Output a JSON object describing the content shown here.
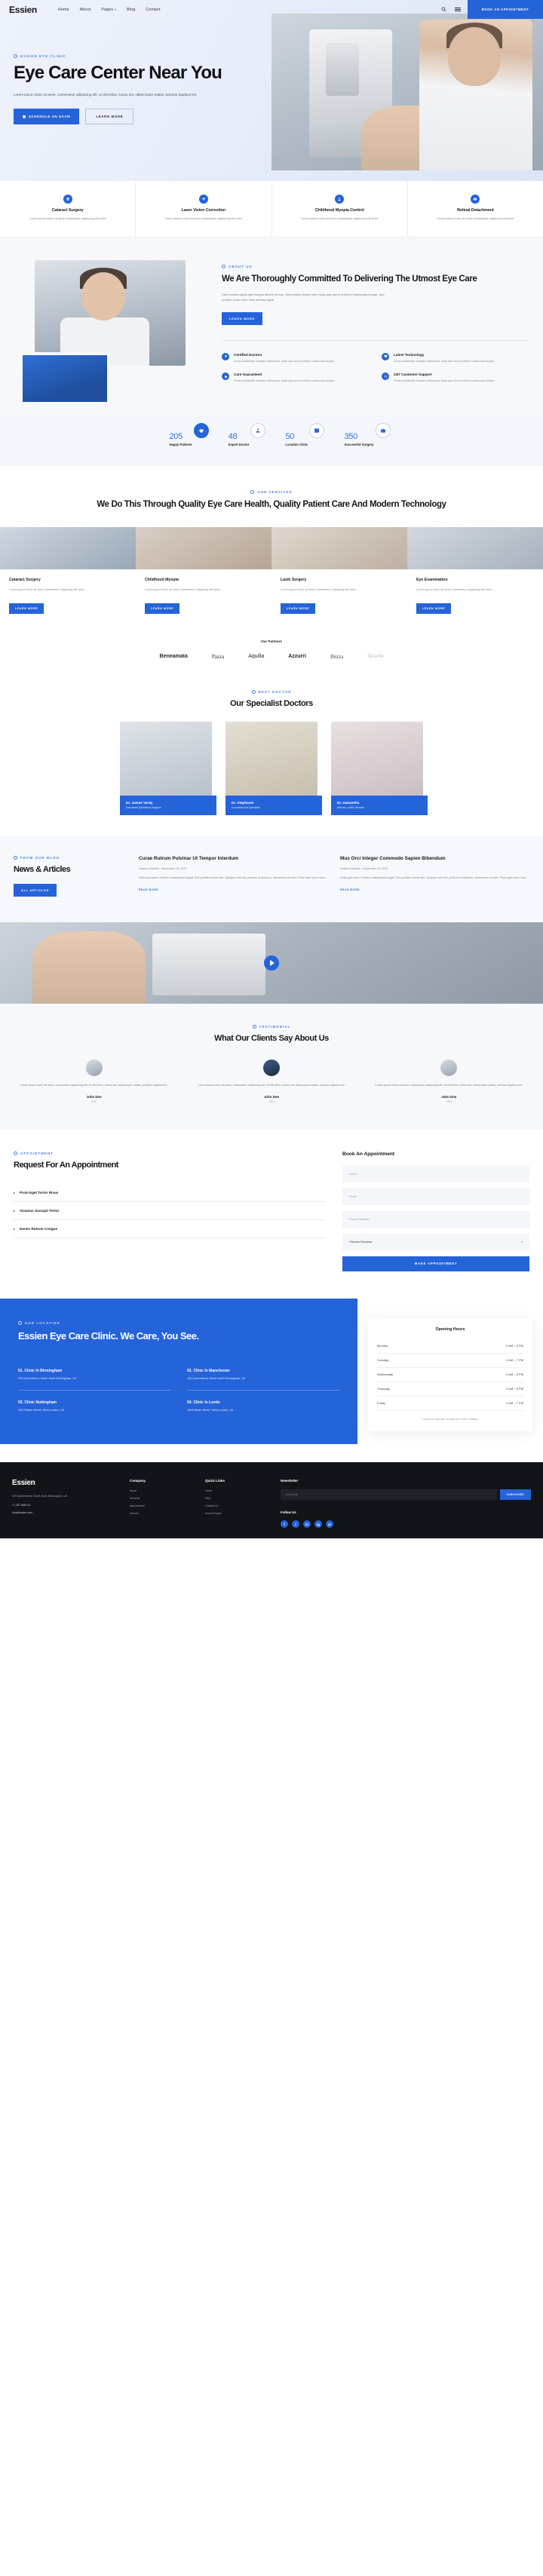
{
  "header": {
    "logo": "Essien",
    "nav": [
      {
        "label": "Home",
        "caret": false
      },
      {
        "label": "About",
        "caret": false
      },
      {
        "label": "Pages",
        "caret": true
      },
      {
        "label": "Blog",
        "caret": false
      },
      {
        "label": "Contact",
        "caret": false
      }
    ],
    "cta": "BOOK AN APPOINTMENT",
    "accent": "#2563d9"
  },
  "hero": {
    "eyebrow": "ESSIEN EYE CLINIC",
    "title": "Eye Care Center Near You",
    "paragraph": "Lorem ipsum dolor sit amet, consectetur adipiscing elit. Ut elit tellus, luctus nec ullamcorper mattis, pulvinar dapibus leo.",
    "primary_btn": "SCHEDULE AN EXAM",
    "secondary_btn": "LEARN MORE"
  },
  "strip": {
    "desc": "Lorem ipsum dolor sit amet consectetur adipiscing elit dolor",
    "items": [
      {
        "title": "Cataract Surgery",
        "icon": "surgery-icon"
      },
      {
        "title": "Laser Vision Correction",
        "icon": "laser-icon"
      },
      {
        "title": "Childhood Myopia Control",
        "icon": "child-icon"
      },
      {
        "title": "Retinal Detachment",
        "icon": "eye-icon"
      }
    ]
  },
  "about": {
    "eyebrow": "ABOUT US",
    "title": "We Are Thoroughly Committed To Delivering The Utmost Eye Care",
    "paragraph": "Duis rhoncus ligula eget magna dictum cursus. Sed porttitor lectus nibh. Nulla quis lorem ut libero malesuada feugiat. Sed porttitor lectus nibh. Duis ultricies ligula.",
    "button": "LEARN MORE",
    "features": [
      {
        "title": "Certified Doctors",
        "text": "Donec sollicitudin molestie malesuada. Nulla quis lorem ut libero malesuada feugiat.",
        "icon": "badge-icon"
      },
      {
        "title": "Latest Technology",
        "text": "Donec sollicitudin molestie malesuada. Nulla quis lorem ut libero malesuada feugiat.",
        "icon": "tech-icon"
      },
      {
        "title": "Care Guaranteed",
        "text": "Donec sollicitudin molestie malesuada. Nulla quis lorem ut libero malesuada feugiat.",
        "icon": "heart-icon"
      },
      {
        "title": "24/7 Customer Support",
        "text": "Donec sollicitudin molestie malesuada. Nulla quis lorem ut libero malesuada feugiat.",
        "icon": "support-icon"
      }
    ]
  },
  "stats": [
    {
      "number": "205",
      "label": "Happy Patients",
      "icon": "heart-icon"
    },
    {
      "number": "48",
      "label": "Expert Doctor",
      "icon": "doctor-icon"
    },
    {
      "number": "50",
      "label": "Location Clinic",
      "icon": "map-icon"
    },
    {
      "number": "350",
      "label": "Successful Surgery",
      "icon": "bag-icon"
    }
  ],
  "services": {
    "eyebrow": "OUR SERVICES",
    "title": "We Do This Through Quality Eye Care Health, Quality Patient Care And Modern Technology",
    "cards": [
      {
        "title": "Cataract Surgery",
        "text": "Lorem ipsum dolor sit amet consectetur adipiscing elit dolor",
        "button": "LEARN MORE"
      },
      {
        "title": "Childhood Myopia",
        "text": "Lorem ipsum dolor sit amet consectetur adipiscing elit dolor",
        "button": "LEARN MORE"
      },
      {
        "title": "Lasik Surgery",
        "text": "Lorem ipsum dolor sit amet consectetur adipiscing elit dolor",
        "button": "LEARN MORE"
      },
      {
        "title": "Eye Examination",
        "text": "Lorem ipsum dolor sit amet consectetur adipiscing elit dolor",
        "button": "LEARN MORE"
      }
    ]
  },
  "partners": {
    "title": "Our Partners",
    "logos": [
      "Beneamata",
      "Pazza",
      "Aquilla",
      "Azzurri",
      "Ibizza",
      "Tenerife"
    ]
  },
  "doctors": {
    "eyebrow": "BEST DOCTOR",
    "title": "Our Specialist Doctors",
    "list": [
      {
        "name": "Dr. James Verdy",
        "role": "Consultant Ophthalmic Surgeon"
      },
      {
        "name": "Dr. Stephanie",
        "role": "Consultant Eye Specialist"
      },
      {
        "name": "Dr. Samantha",
        "role": "Director, LASIK Services"
      }
    ]
  },
  "news": {
    "eyebrow": "FROM OUR BLOG",
    "title": "News & Articles",
    "button": "ALL ARTICLES",
    "posts": [
      {
        "title": "Curae Rutrum Pulvinar Ut Tempor Interdum",
        "meta": "Hassan Mustafa - September 18, 2023",
        "excerpt": "Nulla quis lorem ut libero malesuada feugiat. Sed porttitor lectus nibh. Quisque velit nisi, pretium ut lacinia in, elementum id enim. Proin eget tortor risus.",
        "read_more": "READ MORE"
      },
      {
        "title": "Mus Orci Integer Commodo Sapien Bibendum",
        "meta": "Hassan Mustafa - September 18, 2023",
        "excerpt": "Nulla quis lorem ut libero malesuada feugiat. Sed porttitor lectus nibh. Quisque velit nisi, pretium ut lacinia in, elementum id enim. Proin eget tortor risus.",
        "read_more": "READ MORE"
      }
    ]
  },
  "testimonials": {
    "eyebrow": "TESTIMONIAL",
    "title": "What Our Clients Say About Us",
    "items": [
      {
        "text": "Lorem ipsum dolor sit amet, consectetur adipiscing elit. Ut elit tellus, luctus nec ullamcorper mattis, pulvinar dapibus leo.",
        "name": "John Doe",
        "role": "CEO"
      },
      {
        "text": "Lorem ipsum dolor sit amet, consectetur adipiscing elit. Ut elit tellus, luctus nec ullamcorper mattis, pulvinar dapibus leo.",
        "name": "John Doe",
        "role": "CEO"
      },
      {
        "text": "Lorem ipsum dolor sit amet, consectetur adipiscing elit. Ut elit tellus, luctus nec ullamcorper mattis, pulvinar dapibus leo.",
        "name": "John Doe",
        "role": "CEO"
      }
    ]
  },
  "appointment": {
    "eyebrow": "APPOINTMENT",
    "title": "Request For An Appointment",
    "accordion": [
      "Proin Eget Tortor Risus",
      "Vivamus Suscipit Tortor",
      "Donec Rutrum Congue"
    ],
    "form_title": "Book An Appointment",
    "fields": {
      "name": "Name",
      "email": "Email",
      "phone": "Phone Number",
      "service": "Choose Services"
    },
    "submit": "MAKE APPOINTMENT"
  },
  "location": {
    "eyebrow": "OUR LOCATION",
    "title": "Essien Eye Care Clinic. We Care, You See.",
    "clinics": [
      {
        "name": "01. Clinic In Birmingham",
        "address": "329 Queensberry Street North Birmingham, UK"
      },
      {
        "name": "02. Clinic In Manchester",
        "address": "329 Queensberry Street North Birmingham, UK"
      },
      {
        "name": "03. Clinic Nottingham",
        "address": "150 Fulham Street, West London, UK"
      },
      {
        "name": "04. Clinic In Leeds",
        "address": "150 Fulham Street, West London, UK"
      }
    ],
    "hours_title": "Opening Hours",
    "hours": [
      {
        "day": "Monday",
        "time": "9 AM – 5 PM"
      },
      {
        "day": "Tuesday",
        "time": "9 AM – 7 PM"
      },
      {
        "day": "Wednesday",
        "time": "9 AM – 5 PM"
      },
      {
        "day": "Thursday",
        "time": "9 AM – 5 PM"
      },
      {
        "day": "Friday",
        "time": "9 AM – 7 PM"
      }
    ],
    "hours_note": "Closed on Saturday, Sunday and Public Holidays"
  },
  "footer": {
    "logo": "Essien",
    "address": "329 Queensberry Street North Birmingham, UK",
    "phone": "+1 257 6680 91",
    "email": "info@essien.com",
    "columns": [
      {
        "title": "Company",
        "links": [
          "About",
          "Services",
          "Appointment",
          "Doctors"
        ]
      },
      {
        "title": "Quick Links",
        "links": [
          "Home",
          "FAQ",
          "Contact Us",
          "Social Project"
        ]
      }
    ],
    "newsletter_title": "Newsletter",
    "newsletter_placeholder": "Your Email",
    "newsletter_button": "SUBSCRIBE",
    "follow_title": "Follow Us",
    "socials": [
      "f",
      "t",
      "in",
      "ig",
      "yt"
    ]
  }
}
